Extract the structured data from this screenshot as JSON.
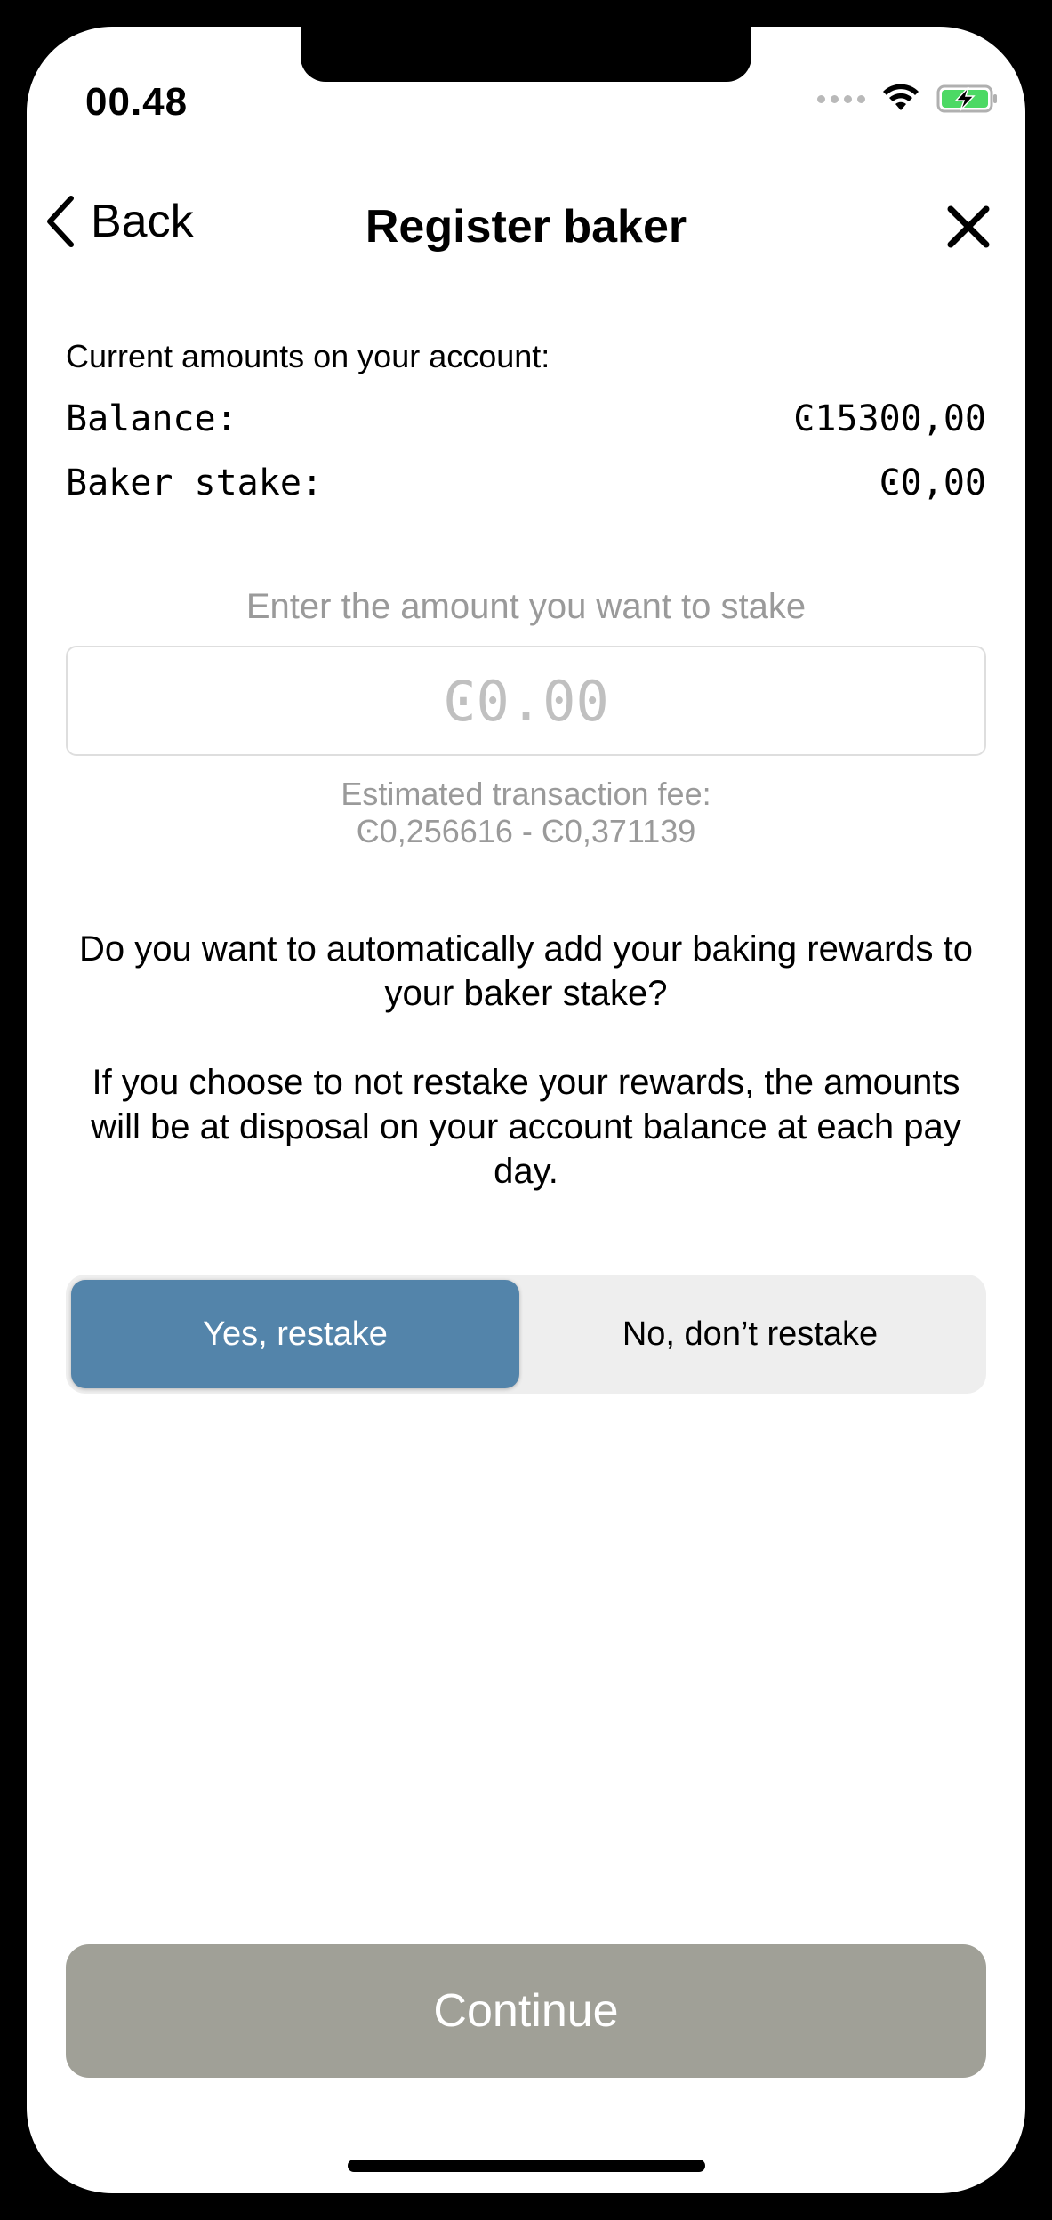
{
  "status_bar": {
    "time": "00.48"
  },
  "nav": {
    "back_label": "Back",
    "title": "Register baker"
  },
  "amounts": {
    "heading": "Current amounts on your account:",
    "rows": [
      {
        "label": "Balance:",
        "value": "Ͼ15300,00"
      },
      {
        "label": "Baker stake:",
        "value": "Ͼ0,00"
      }
    ]
  },
  "stake_input": {
    "prompt": "Enter the amount you want to stake",
    "placeholder": "Ͼ0.00",
    "value": ""
  },
  "fee": {
    "label": "Estimated transaction fee:",
    "range": "Ͼ0,256616 - Ͼ0,371139"
  },
  "restake": {
    "question": "Do you want to automatically add your baking rewards to your baker stake?",
    "explanation": "If you choose to not restake your rewards, the amounts will be at disposal on your account balance at each pay day.",
    "options": [
      {
        "label": "Yes, restake",
        "selected": true
      },
      {
        "label": "No, don’t restake",
        "selected": false
      }
    ]
  },
  "continue_label": "Continue",
  "colors": {
    "accent": "#5384aa",
    "disabled_button": "#a0a097",
    "muted_text": "#9a9a9a"
  },
  "icons": [
    "signal-dots-icon",
    "wifi-icon",
    "battery-charging-icon",
    "chevron-left-icon",
    "close-icon"
  ]
}
